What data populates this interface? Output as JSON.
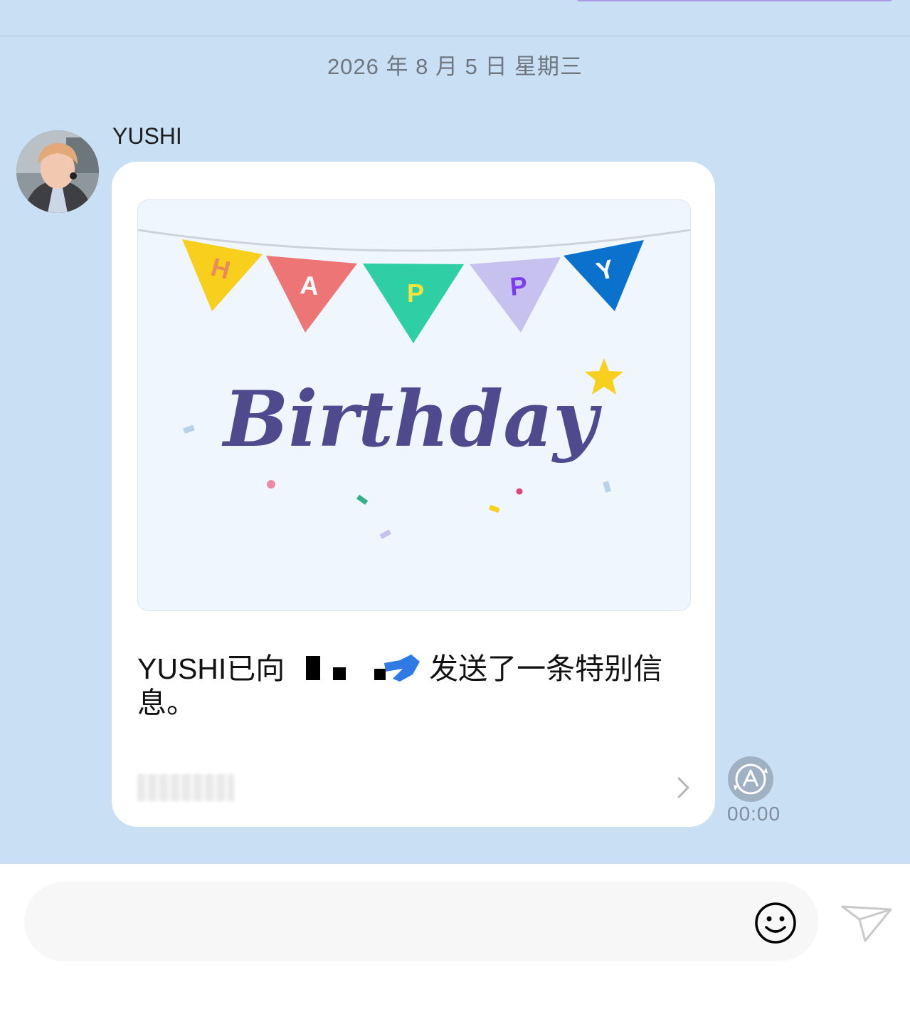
{
  "date_divider": "2026 年 8 月 5 日 星期三",
  "chat": {
    "sender_name": "YUSHI",
    "card": {
      "banner_letters": [
        "H",
        "A",
        "P",
        "P",
        "Y"
      ],
      "banner_colors": [
        "#f7cf1c",
        "#ee7575",
        "#2ecfa5",
        "#c6c1ee",
        "#0a72cd"
      ],
      "letter_colors": [
        "#e98c5a",
        "#ffffff",
        "#f7e23c",
        "#7b3cf2",
        "#ffffff"
      ],
      "headline": "Birthday",
      "headline_color": "#4f4a8e",
      "message_prefix": "YUSHI已向",
      "message_suffix": "发送了一条特别信息。"
    },
    "timestamp": "00:00"
  },
  "composer": {
    "placeholder": ""
  },
  "icons": {
    "translate": "translate-icon",
    "emoji": "smiley-icon",
    "send": "paper-plane-icon",
    "chevron": "chevron-right-icon"
  }
}
